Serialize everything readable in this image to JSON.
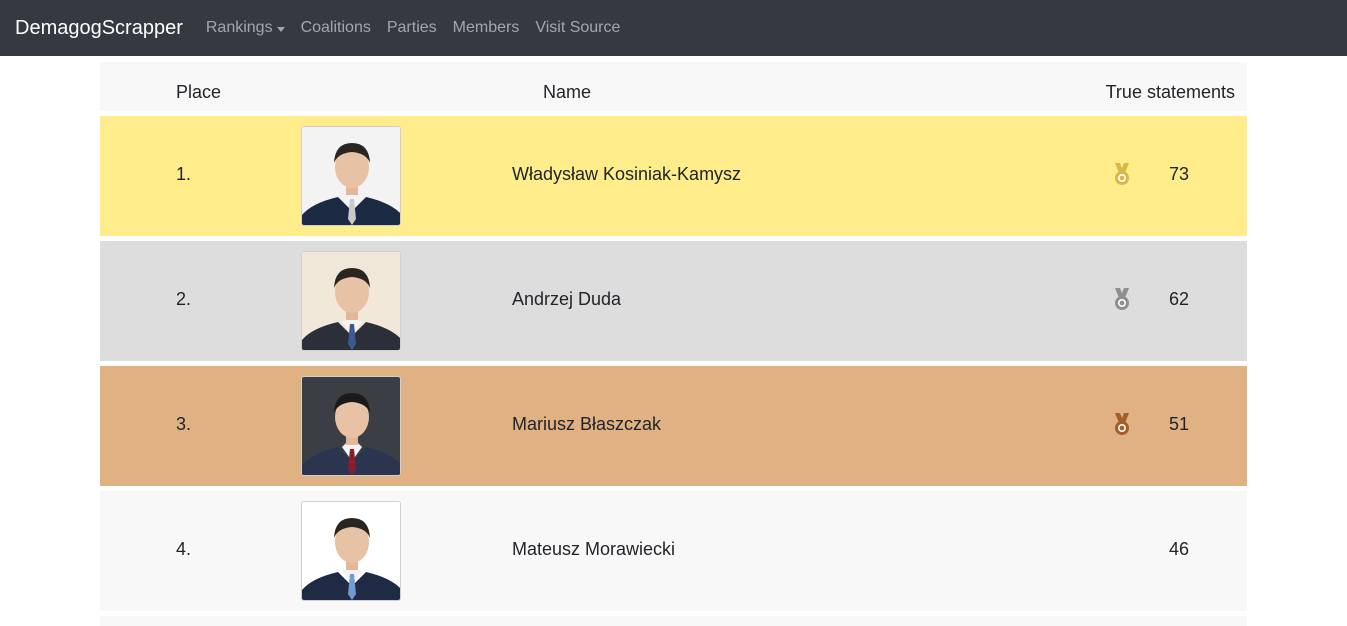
{
  "navbar": {
    "brand": "DemagogScrapper",
    "items": [
      {
        "label": "Rankings",
        "dropdown": true
      },
      {
        "label": "Coalitions"
      },
      {
        "label": "Parties"
      },
      {
        "label": "Members"
      },
      {
        "label": "Visit Source"
      }
    ],
    "colors": {
      "background": "#343a40",
      "link": "rgba(255,255,255,0.55)",
      "brand": "#ffffff"
    }
  },
  "table": {
    "headers": {
      "place": "Place",
      "name": "Name",
      "true_statements": "True statements"
    },
    "rows": [
      {
        "place": "1.",
        "name": "Władysław Kosiniak-Kamysz",
        "count": "73",
        "medal": "gold-medal-icon",
        "row_color": "#ffec8b",
        "medal_color": "#d9b84a",
        "suit": "#1c2a44",
        "tie": "#c9c9c9",
        "bg": "#f3f3f3"
      },
      {
        "place": "2.",
        "name": "Andrzej Duda",
        "count": "62",
        "medal": "silver-medal-icon",
        "row_color": "#dddddd",
        "medal_color": "#8f8f8f",
        "suit": "#2a2f3a",
        "tie": "#3b5b8f",
        "bg": "#f1e8da"
      },
      {
        "place": "3.",
        "name": "Mariusz Błaszczak",
        "count": "51",
        "medal": "bronze-medal-icon",
        "row_color": "#e0b183",
        "medal_color": "#a45e2a",
        "suit": "#2b3550",
        "tie": "#8b1d2c",
        "bg": "#3b3f45"
      },
      {
        "place": "4.",
        "name": "Mateusz Morawiecki",
        "count": "46",
        "medal": null,
        "row_color": "#f8f8f8",
        "medal_color": null,
        "suit": "#1f2a44",
        "tie": "#6f9bd0",
        "bg": "#ffffff"
      }
    ]
  }
}
